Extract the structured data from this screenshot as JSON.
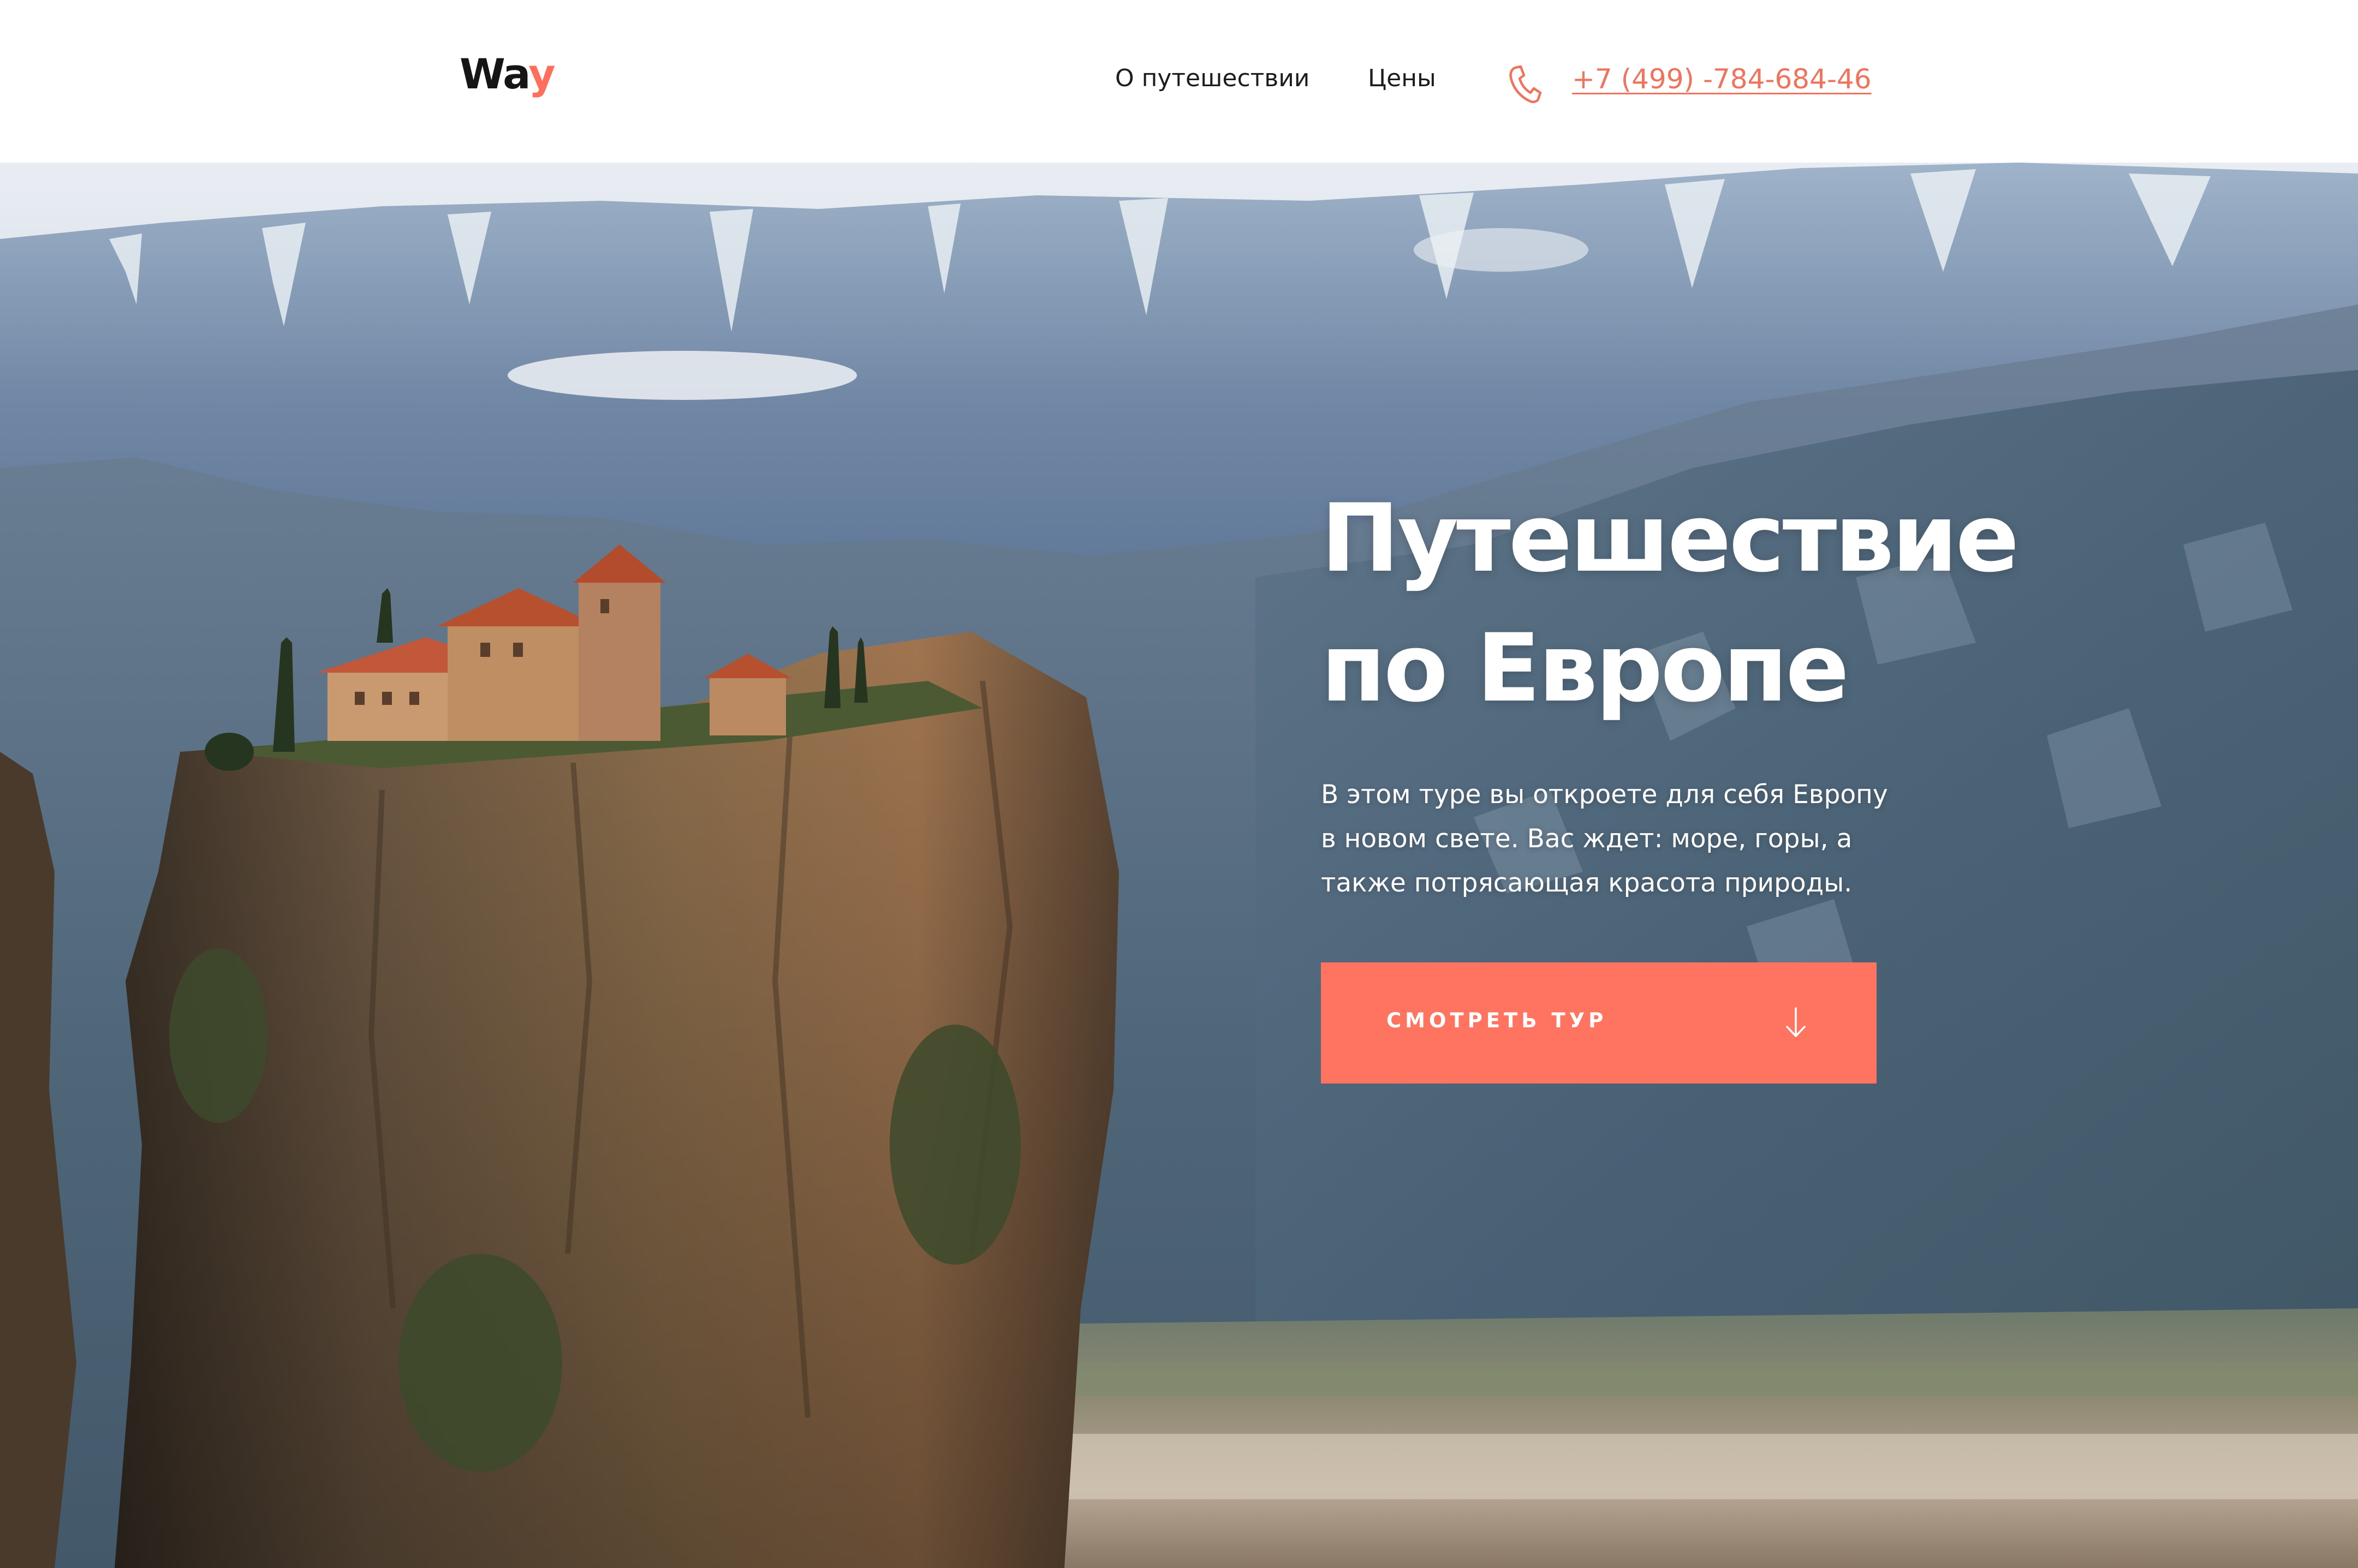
{
  "header": {
    "logo_main": "Wa",
    "logo_accent": "y",
    "nav": [
      {
        "label": "О путешествии"
      },
      {
        "label": "Цены"
      }
    ],
    "phone": "+7 (499) -784-684-46",
    "phone_icon": "phone-icon"
  },
  "hero": {
    "title_line1": "Путешествие",
    "title_line2": "по Европе",
    "description": "В этом туре вы откроете для себя Европу в новом свете. Вас ждет: море, горы, а также потрясающая красота природы.",
    "button_label": "СМОТРЕТЬ ТУР",
    "button_icon": "arrow-down-icon"
  },
  "colors": {
    "accent": "#ff7461",
    "phone_link": "#f0735d",
    "text_dark": "#1d1d1d",
    "hero_text": "#ffffff"
  }
}
